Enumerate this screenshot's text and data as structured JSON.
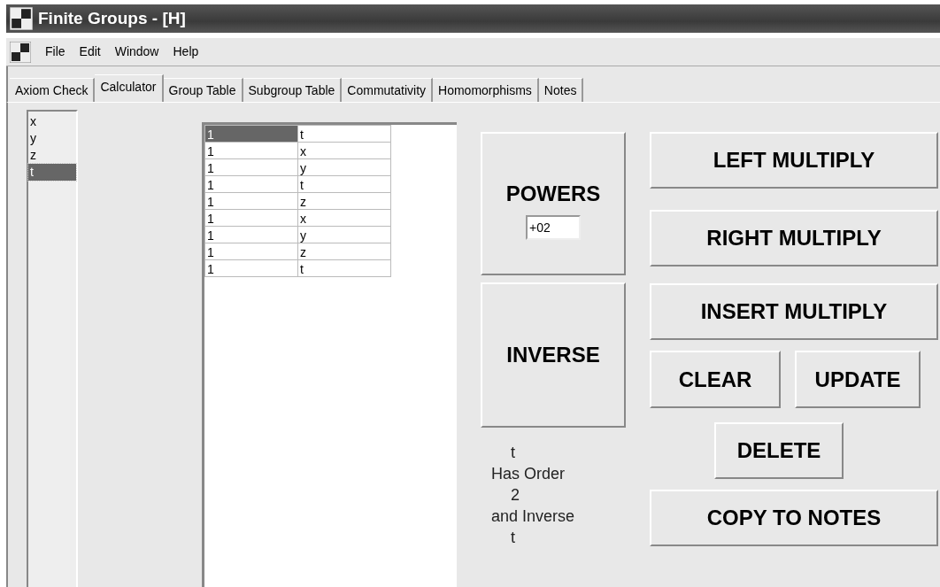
{
  "window": {
    "title": "Finite Groups - [H]"
  },
  "menu": [
    "File",
    "Edit",
    "Window",
    "Help"
  ],
  "tabs": [
    {
      "label": "Axiom Check",
      "selected": false
    },
    {
      "label": "Calculator",
      "selected": true
    },
    {
      "label": "Group Table",
      "selected": false
    },
    {
      "label": "Subgroup Table",
      "selected": false
    },
    {
      "label": "Commutativity",
      "selected": false
    },
    {
      "label": "Homomorphisms",
      "selected": false
    },
    {
      "label": "Notes",
      "selected": false
    }
  ],
  "elements": [
    {
      "label": "x",
      "selected": false
    },
    {
      "label": "y",
      "selected": false
    },
    {
      "label": "z",
      "selected": false
    },
    {
      "label": "t",
      "selected": true
    }
  ],
  "table": {
    "rows": [
      {
        "cells": [
          "1",
          "t"
        ],
        "selected": true
      },
      {
        "cells": [
          "1",
          "x"
        ],
        "selected": false
      },
      {
        "cells": [
          "1",
          "y"
        ],
        "selected": false
      },
      {
        "cells": [
          "1",
          "t"
        ],
        "selected": false
      },
      {
        "cells": [
          "1",
          "z"
        ],
        "selected": false
      },
      {
        "cells": [
          "1",
          "x"
        ],
        "selected": false
      },
      {
        "cells": [
          "1",
          "y"
        ],
        "selected": false
      },
      {
        "cells": [
          "1",
          "z"
        ],
        "selected": false
      },
      {
        "cells": [
          "1",
          "t"
        ],
        "selected": false
      }
    ]
  },
  "powers": {
    "label": "POWERS",
    "value": "+02"
  },
  "inverse_button": "INVERSE",
  "buttons": [
    "LEFT MULTIPLY",
    "RIGHT MULTIPLY",
    "INSERT MULTIPLY",
    "CLEAR",
    "UPDATE",
    "DELETE",
    "COPY TO NOTES"
  ],
  "result": [
    {
      "text": "t",
      "kind": "value"
    },
    {
      "text": "Has Order",
      "kind": "caption"
    },
    {
      "text": "2",
      "kind": "value"
    },
    {
      "text": "and Inverse",
      "kind": "caption"
    },
    {
      "text": "t",
      "kind": "value"
    }
  ]
}
